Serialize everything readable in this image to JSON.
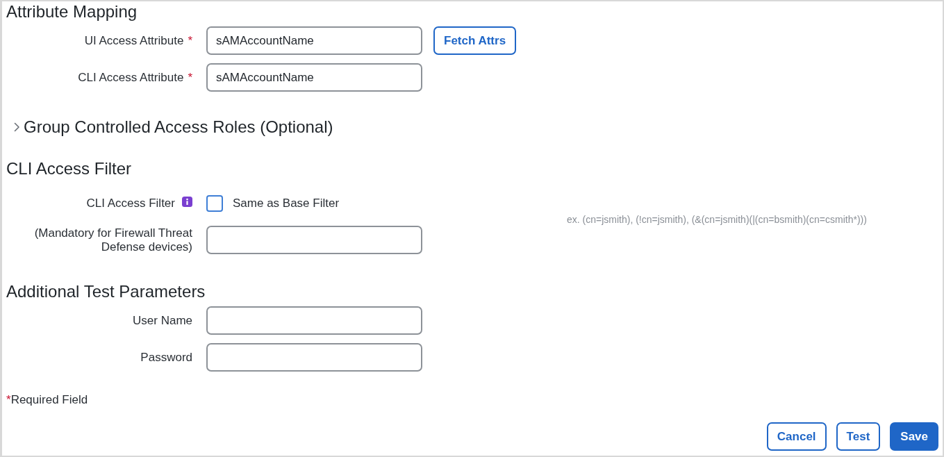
{
  "attribute_mapping": {
    "title": "Attribute Mapping",
    "fields": [
      {
        "label": "UI Access Attribute",
        "required_mark": "*",
        "value": "sAMAccountName",
        "button": "Fetch Attrs"
      },
      {
        "label": "CLI Access Attribute",
        "required_mark": "*",
        "value": "sAMAccountName"
      }
    ]
  },
  "group_roles": {
    "title": "Group Controlled Access Roles (Optional)",
    "expanded": false
  },
  "cli_access_filter": {
    "title": "CLI Access Filter",
    "label": "CLI Access Filter",
    "checkbox": {
      "label": "Same as Base Filter",
      "checked": false
    },
    "filter_field": {
      "label": "(Mandatory for Firewall Threat Defense devices)"
    },
    "hint": "ex. (cn=jsmith), (!cn=jsmith), (&(cn=jsmith)(|(cn=bsmith)(cn=csmith*)))"
  },
  "test_parameters": {
    "title": "Additional Test Parameters",
    "fields": [
      {
        "label": "User Name"
      },
      {
        "label": "Password"
      }
    ]
  },
  "footnote": {
    "mark": "*",
    "text": "Required Field"
  },
  "buttons": [
    {
      "label": "Cancel",
      "kind": "secondary"
    },
    {
      "label": "Test",
      "kind": "secondary"
    },
    {
      "label": "Save",
      "kind": "primary"
    }
  ]
}
